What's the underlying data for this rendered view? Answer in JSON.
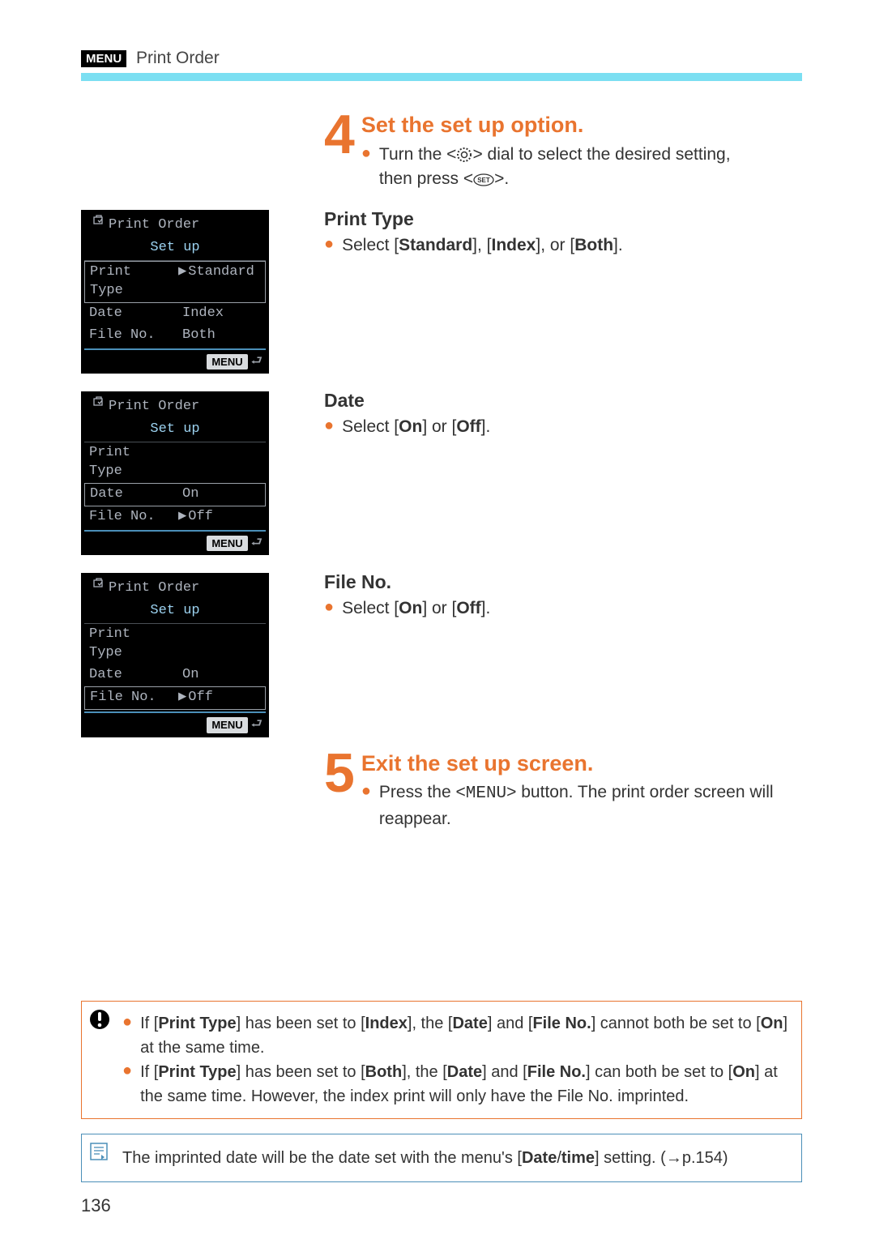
{
  "header": {
    "menu_tag": "MENU",
    "title": "Print Order"
  },
  "step4": {
    "num": "4",
    "title": "Set the set up option.",
    "line1_pre": "Turn the <",
    "line1_mid": "> dial to select the desired setting,",
    "line2_pre": "then press <",
    "line2_post": ">."
  },
  "sect_pt": {
    "title": "Print Type",
    "text_pre": "Select [",
    "b1": "Standard",
    "sep1": "], [",
    "b2": "Index",
    "sep2": "], or [",
    "b3": "Both",
    "post": "]."
  },
  "sect_date": {
    "title": "Date",
    "text_pre": "Select [",
    "b1": "On",
    "sep": "] or [",
    "b2": "Off",
    "post": "]."
  },
  "sect_fn": {
    "title": "File No.",
    "text_pre": "Select [",
    "b1": "On",
    "sep": "] or [",
    "b2": "Off",
    "post": "]."
  },
  "step5": {
    "num": "5",
    "title": "Exit the set up screen.",
    "text_pre": "Press the <",
    "menu_word": "MENU",
    "text_post": "> button. The print order screen will reappear."
  },
  "lcd": {
    "title": "Print Order",
    "tab": "Set up",
    "pt": "Print Type",
    "date": "Date",
    "fn": "File No.",
    "std": "Standard",
    "idx": "Index",
    "both": "Both",
    "on": "On",
    "off": "Off",
    "menu": "MENU"
  },
  "notes": {
    "n1_pre": "If [",
    "n1_b1": "Print Type",
    "n1_mid1": "] has been set to [",
    "n1_b2": "Index",
    "n1_mid2": "], the [",
    "n1_b3": "Date",
    "n1_mid3": "] and [",
    "n1_b4": "File No.",
    "n1_mid4": "] cannot both be set to [",
    "n1_b5": "On",
    "n1_post": "] at the same time.",
    "n2_pre": "If [",
    "n2_b1": "Print Type",
    "n2_mid1": "] has been set to [",
    "n2_b2": "Both",
    "n2_mid2": "], the [",
    "n2_b3": "Date",
    "n2_mid3": "] and [",
    "n2_b4": "File No.",
    "n2_mid4": "] can both be set to [",
    "n2_b5": "On",
    "n2_post": "] at the same time. However, the index print will only have the File No. imprinted."
  },
  "info": {
    "pre": "The imprinted date will be the date set with the menu's [",
    "b1": "Date",
    "slash": "/",
    "b2": "time",
    "post": "] setting. (→p.154)"
  },
  "page_no": "136"
}
